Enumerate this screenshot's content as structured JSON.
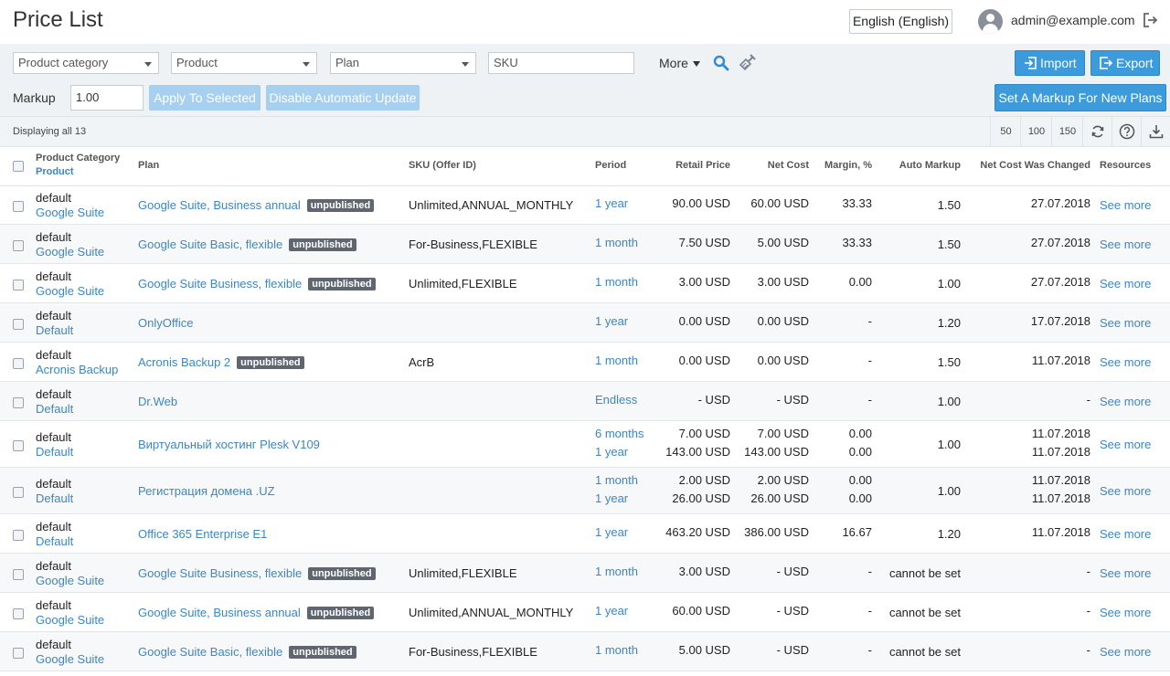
{
  "header": {
    "title": "Price List",
    "language": "English (English)",
    "user": "admin@example.com"
  },
  "filters": {
    "product_category": "Product category",
    "product": "Product",
    "plan": "Plan",
    "sku": "SKU",
    "more": "More",
    "import": "Import",
    "export": "Export"
  },
  "markup": {
    "label": "Markup",
    "value": "1.00",
    "apply": "Apply To Selected",
    "disable": "Disable Automatic Update",
    "new_plans": "Set A Markup For New Plans"
  },
  "display": {
    "text": "Displaying all 13",
    "page_sizes": [
      "50",
      "100",
      "150"
    ]
  },
  "columns": {
    "category": "Product Category",
    "product": "Product",
    "plan": "Plan",
    "sku": "SKU (Offer ID)",
    "period": "Period",
    "retail": "Retail Price",
    "netcost": "Net Cost",
    "margin": "Margin, %",
    "auto": "Auto Markup",
    "changed": "Net Cost Was Changed",
    "resources": "Resources"
  },
  "rows": [
    {
      "category": "default",
      "product": "Google Suite",
      "plan": "Google Suite, Business annual",
      "badge": "unpublished",
      "sku": "Unlimited,ANNUAL_MONTHLY",
      "periods": [
        "1 year"
      ],
      "retail": [
        "90.00 USD"
      ],
      "netcost": [
        "60.00 USD"
      ],
      "margin": [
        "33.33"
      ],
      "auto": "1.50",
      "changed": [
        "27.07.2018"
      ],
      "resources": "See more"
    },
    {
      "category": "default",
      "product": "Google Suite",
      "plan": "Google Suite Basic, flexible",
      "badge": "unpublished",
      "sku": "For-Business,FLEXIBLE",
      "periods": [
        "1 month"
      ],
      "retail": [
        "7.50 USD"
      ],
      "netcost": [
        "5.00 USD"
      ],
      "margin": [
        "33.33"
      ],
      "auto": "1.50",
      "changed": [
        "27.07.2018"
      ],
      "resources": "See more"
    },
    {
      "category": "default",
      "product": "Google Suite",
      "plan": "Google Suite Business, flexible",
      "badge": "unpublished",
      "sku": "Unlimited,FLEXIBLE",
      "periods": [
        "1 month"
      ],
      "retail": [
        "3.00 USD"
      ],
      "netcost": [
        "3.00 USD"
      ],
      "margin": [
        "0.00"
      ],
      "auto": "1.00",
      "changed": [
        "27.07.2018"
      ],
      "resources": "See more"
    },
    {
      "category": "default",
      "product": "Default",
      "plan": "OnlyOffice",
      "badge": "",
      "sku": "",
      "periods": [
        "1 year"
      ],
      "retail": [
        "0.00 USD"
      ],
      "netcost": [
        "0.00 USD"
      ],
      "margin": [
        "-"
      ],
      "auto": "1.20",
      "changed": [
        "17.07.2018"
      ],
      "resources": "See more"
    },
    {
      "category": "default",
      "product": "Acronis Backup",
      "plan": "Acronis Backup 2",
      "badge": "unpublished",
      "sku": "AcrB",
      "periods": [
        "1 month"
      ],
      "retail": [
        "0.00 USD"
      ],
      "netcost": [
        "0.00 USD"
      ],
      "margin": [
        "-"
      ],
      "auto": "1.50",
      "changed": [
        "11.07.2018"
      ],
      "resources": "See more"
    },
    {
      "category": "default",
      "product": "Default",
      "plan": "Dr.Web",
      "badge": "",
      "sku": "",
      "periods": [
        "Endless"
      ],
      "retail": [
        "- USD"
      ],
      "netcost": [
        "- USD"
      ],
      "margin": [
        "-"
      ],
      "auto": "1.00",
      "changed": [
        "-"
      ],
      "resources": "See more"
    },
    {
      "category": "default",
      "product": "Default",
      "plan": "Виртуальный хостинг Plesk V109",
      "badge": "",
      "sku": "",
      "periods": [
        "6 months",
        "1 year"
      ],
      "retail": [
        "7.00 USD",
        "143.00 USD"
      ],
      "netcost": [
        "7.00 USD",
        "143.00 USD"
      ],
      "margin": [
        "0.00",
        "0.00"
      ],
      "auto": "1.00",
      "changed": [
        "11.07.2018",
        "11.07.2018"
      ],
      "resources": "See more"
    },
    {
      "category": "default",
      "product": "Default",
      "plan": "Регистрация домена .UZ",
      "badge": "",
      "sku": "",
      "periods": [
        "1 month",
        "1 year"
      ],
      "retail": [
        "2.00 USD",
        "26.00 USD"
      ],
      "netcost": [
        "2.00 USD",
        "26.00 USD"
      ],
      "margin": [
        "0.00",
        "0.00"
      ],
      "auto": "1.00",
      "changed": [
        "11.07.2018",
        "11.07.2018"
      ],
      "resources": "See more"
    },
    {
      "category": "default",
      "product": "Default",
      "plan": "Office 365 Enterprise E1",
      "badge": "",
      "sku": "",
      "periods": [
        "1 year"
      ],
      "retail": [
        "463.20 USD"
      ],
      "netcost": [
        "386.00 USD"
      ],
      "margin": [
        "16.67"
      ],
      "auto": "1.20",
      "changed": [
        "11.07.2018"
      ],
      "resources": "See more"
    },
    {
      "category": "default",
      "product": "Google Suite",
      "plan": "Google Suite Business, flexible",
      "badge": "unpublished",
      "sku": "Unlimited,FLEXIBLE",
      "periods": [
        "1 month"
      ],
      "retail": [
        "3.00 USD"
      ],
      "netcost": [
        "- USD"
      ],
      "margin": [
        "-"
      ],
      "auto": "cannot be set",
      "changed": [
        "-"
      ],
      "resources": "See more"
    },
    {
      "category": "default",
      "product": "Google Suite",
      "plan": "Google Suite, Business annual",
      "badge": "unpublished",
      "sku": "Unlimited,ANNUAL_MONTHLY",
      "periods": [
        "1 year"
      ],
      "retail": [
        "60.00 USD"
      ],
      "netcost": [
        "- USD"
      ],
      "margin": [
        "-"
      ],
      "auto": "cannot be set",
      "changed": [
        "-"
      ],
      "resources": "See more"
    },
    {
      "category": "default",
      "product": "Google Suite",
      "plan": "Google Suite Basic, flexible",
      "badge": "unpublished",
      "sku": "For-Business,FLEXIBLE",
      "periods": [
        "1 month"
      ],
      "retail": [
        "5.00 USD"
      ],
      "netcost": [
        "- USD"
      ],
      "margin": [
        "-"
      ],
      "auto": "cannot be set",
      "changed": [
        "-"
      ],
      "resources": "See more"
    }
  ],
  "colors": {
    "accent": "#3d9bdc",
    "link": "#3b86c6",
    "badge": "#5f6670",
    "disabled": "#a7cff0"
  }
}
